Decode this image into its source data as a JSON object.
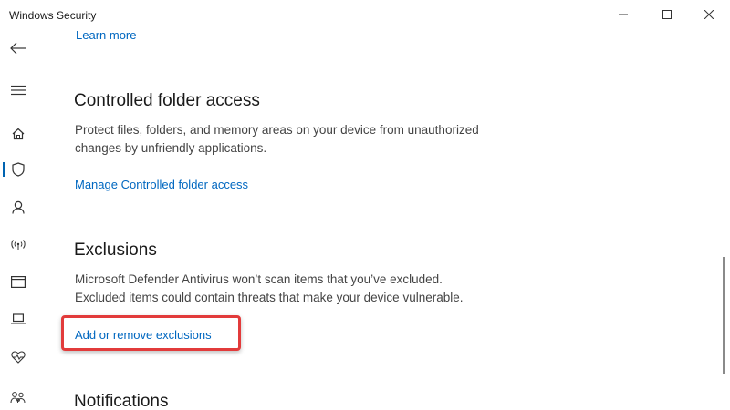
{
  "window": {
    "title": "Windows Security",
    "controls": {
      "minimize": "minimize-icon",
      "maximize": "maximize-icon",
      "close": "close-icon"
    }
  },
  "rail": {
    "items": [
      {
        "name": "back",
        "icon": "back-arrow-icon"
      },
      {
        "name": "menu",
        "icon": "hamburger-menu-icon"
      },
      {
        "name": "home",
        "icon": "home-icon"
      },
      {
        "name": "virus-threat-protection",
        "icon": "shield-icon",
        "active": true
      },
      {
        "name": "account-protection",
        "icon": "person-icon"
      },
      {
        "name": "firewall-network",
        "icon": "wifi-antenna-icon"
      },
      {
        "name": "app-browser-control",
        "icon": "app-window-icon"
      },
      {
        "name": "device-security",
        "icon": "laptop-icon"
      },
      {
        "name": "device-performance",
        "icon": "heart-pulse-icon"
      },
      {
        "name": "family-options",
        "icon": "family-icon"
      }
    ],
    "accent": "#0063b1"
  },
  "content": {
    "learn_more": "Learn more",
    "sections": [
      {
        "heading": "Controlled folder access",
        "description_lines": [
          "Protect files, folders, and memory areas on your device from unauthorized",
          "changes by unfriendly applications."
        ],
        "link": "Manage Controlled folder access"
      },
      {
        "heading": "Exclusions",
        "description_lines": [
          "Microsoft Defender Antivirus won’t scan items that you’ve excluded.",
          "Excluded items could contain threats that make your device vulnerable."
        ],
        "link": "Add or remove exclusions",
        "highlighted": true
      },
      {
        "heading": "Notifications"
      }
    ]
  },
  "colors": {
    "link": "#0067c0",
    "highlight_border": "#e23b3b",
    "heading": "#1a1a1a",
    "body_text": "#444444"
  }
}
